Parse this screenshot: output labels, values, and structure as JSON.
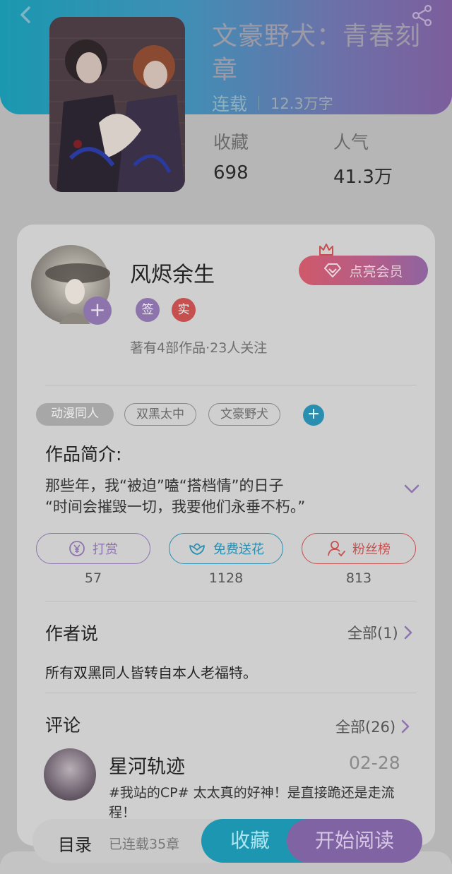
{
  "book": {
    "title": "文豪野犬：青春刻章",
    "status": "连载",
    "word_count": "12.3万字",
    "stats": [
      {
        "label": "收藏",
        "value": "698"
      },
      {
        "label": "人气",
        "value": "41.3万"
      }
    ]
  },
  "author": {
    "name": "风烬余生",
    "badges": [
      "签",
      "实"
    ],
    "meta": "著有4部作品·23人关注",
    "follow_symbol": "+",
    "member_button": "点亮会员"
  },
  "tags": {
    "items": [
      "动漫同人",
      "双黑太中",
      "文豪野犬"
    ],
    "add_symbol": "+"
  },
  "synopsis": {
    "title": "作品简介:",
    "lines": [
      "那些年，我“被迫”嗑“搭档情”的日子",
      "“时间会摧毁一切，我要他们永垂不朽。”"
    ]
  },
  "actions": [
    {
      "label": "打赏",
      "count": "57",
      "icon": "yen-coin-icon",
      "color": "#8e74ad"
    },
    {
      "label": "免费送花",
      "count": "1128",
      "icon": "flower-icon",
      "color": "#2a8eb0"
    },
    {
      "label": "粉丝榜",
      "count": "813",
      "icon": "fan-user-icon",
      "color": "#c5504f"
    }
  ],
  "author_says": {
    "title": "作者说",
    "all_link": "全部(1)",
    "text": "所有双黑同人皆转自本人老福特。"
  },
  "comments": {
    "title": "评论",
    "all_link": "全部(26)",
    "items": [
      {
        "user": "星河轨迹",
        "date": "02-28",
        "text": "#我站的CP# 太太真的好神！是直接跪还是走流程！"
      }
    ]
  },
  "bottom_bar": {
    "toc_label": "目录",
    "serial_count": "已连载35章",
    "favorite_label": "收藏",
    "read_label": "开始阅读"
  },
  "colors": {
    "header_gradient_start": "#1a98b0",
    "header_gradient_end": "#7c5e9c",
    "accent_purple": "#8e74ad",
    "accent_teal": "#2a8eb0",
    "accent_red": "#c5504f"
  }
}
